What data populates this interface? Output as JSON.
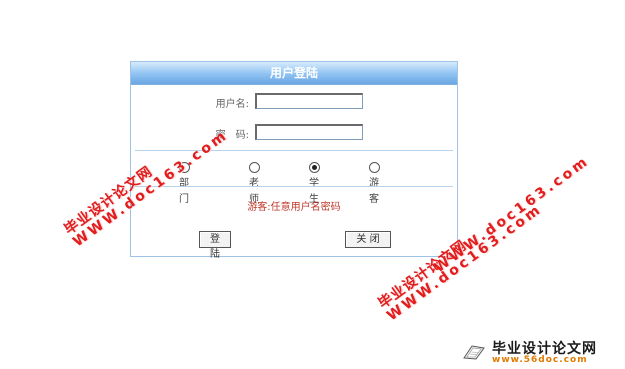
{
  "login": {
    "title": "用户登陆",
    "username_label": "用户名:",
    "username_value": "",
    "password_label": "密　码:",
    "password_value": "",
    "roles": [
      {
        "label": "部门",
        "checked": false
      },
      {
        "label": "老师",
        "checked": false
      },
      {
        "label": "学生",
        "checked": true
      },
      {
        "label": "游客",
        "checked": false
      }
    ],
    "hint": "游客:任意用户名密码",
    "login_button": "登 陆",
    "close_button": "关 闭"
  },
  "watermarks": {
    "cn": "毕业设计论文网",
    "url": "WWW.doc163.com"
  },
  "footer_logo": {
    "cn": "毕业设计论文网",
    "url": "www.56doc.com"
  },
  "colors": {
    "header_gradient_top": "#d7ebfc",
    "header_gradient_bottom": "#6aa7e3",
    "panel_border": "#9ec3e6",
    "hint": "#c0392b",
    "watermark": "#e11d1d",
    "logo_url": "#e07b00"
  }
}
